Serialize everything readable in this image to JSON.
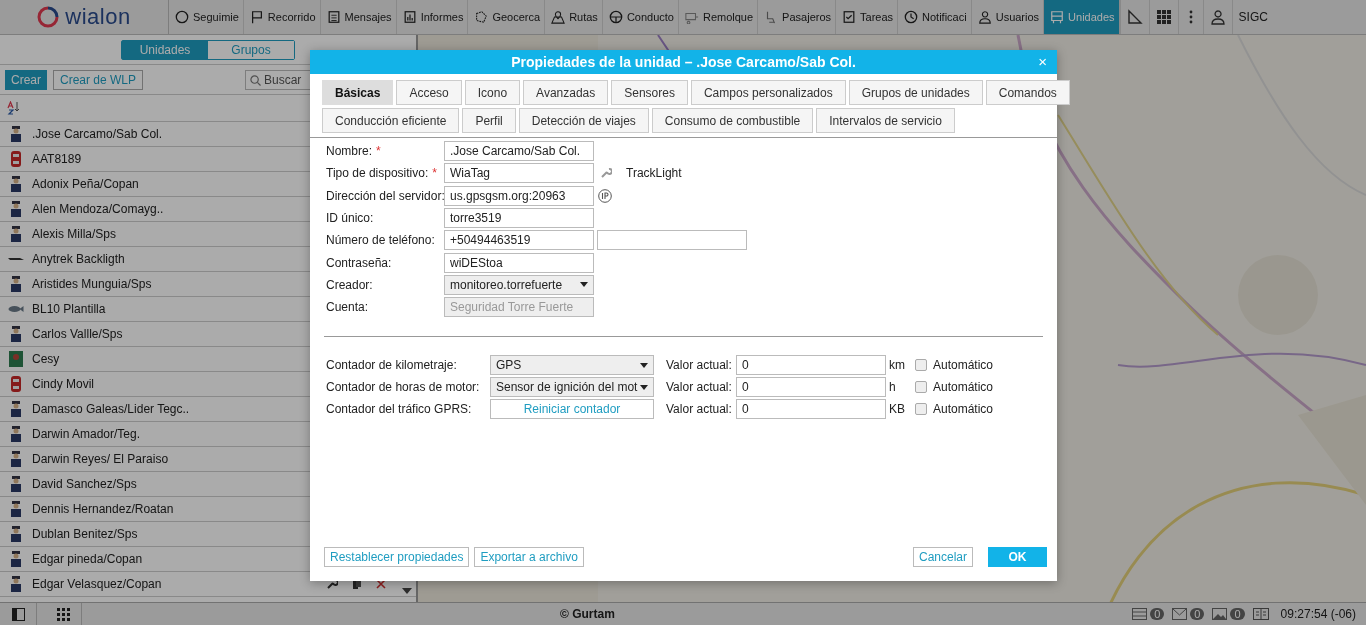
{
  "topbar": {
    "logo": "wialon",
    "tabs": [
      {
        "label": "Seguimie",
        "selected": false
      },
      {
        "label": "Recorrido",
        "selected": false
      },
      {
        "label": "Mensajes",
        "selected": false
      },
      {
        "label": "Informes",
        "selected": false
      },
      {
        "label": "Geocerca",
        "selected": false
      },
      {
        "label": "Rutas",
        "selected": false
      },
      {
        "label": "Conducto",
        "selected": false
      },
      {
        "label": "Remolque",
        "selected": false
      },
      {
        "label": "Pasajeros",
        "selected": false
      },
      {
        "label": "Tareas",
        "selected": false
      },
      {
        "label": "Notificaci",
        "selected": false
      },
      {
        "label": "Usuarios",
        "selected": false
      },
      {
        "label": "Unidades",
        "selected": true
      }
    ],
    "user": "SIGC"
  },
  "sidebar": {
    "segments": [
      {
        "label": "Unidades",
        "selected": true
      },
      {
        "label": "Grupos",
        "selected": false
      }
    ],
    "create": "Crear",
    "create_wlp": "Crear de WLP",
    "search": {
      "placeholder": "Buscar"
    },
    "units": [
      {
        "name": ".Jose Carcamo/Sab Col.",
        "kind": "person"
      },
      {
        "name": "AAT8189",
        "kind": "car"
      },
      {
        "name": "Adonix Peña/Copan",
        "kind": "person"
      },
      {
        "name": "Alen Mendoza/Comayg..",
        "kind": "person"
      },
      {
        "name": "Alexis Milla/Sps",
        "kind": "person"
      },
      {
        "name": "Anytrek Backligth",
        "kind": "device"
      },
      {
        "name": "Aristides Munguia/Sps",
        "kind": "person"
      },
      {
        "name": "BL10 Plantilla",
        "kind": "fish"
      },
      {
        "name": "Carlos Vallle/Sps",
        "kind": "person"
      },
      {
        "name": "Cesy"
      },
      {
        "name": "Cindy Movil",
        "kind": "car"
      },
      {
        "name": "Damasco Galeas/Lider Tegc..",
        "kind": "person"
      },
      {
        "name": "Darwin Amador/Teg.",
        "kind": "person"
      },
      {
        "name": "Darwin Reyes/ El Paraiso",
        "kind": "person"
      },
      {
        "name": "David Sanchez/Sps",
        "kind": "person"
      },
      {
        "name": "Dennis Hernandez/Roatan",
        "kind": "person"
      },
      {
        "name": "Dublan Benitez/Sps",
        "kind": "person"
      },
      {
        "name": "Edgar pineda/Copan",
        "kind": "person"
      },
      {
        "name": "Edgar Velasquez/Copan",
        "kind": "person"
      }
    ]
  },
  "dialog": {
    "title": "Propiedades de la unidad – .Jose Carcamo/Sab Col.",
    "close": "×",
    "tabs": [
      [
        {
          "label": "Básicas",
          "selected": true
        },
        {
          "label": "Acceso",
          "selected": false
        },
        {
          "label": "Icono",
          "selected": false
        },
        {
          "label": "Avanzadas",
          "selected": false
        },
        {
          "label": "Sensores",
          "selected": false
        },
        {
          "label": "Campos personalizados",
          "selected": false
        },
        {
          "label": "Grupos de unidades",
          "selected": false
        },
        {
          "label": "Comandos",
          "selected": false
        }
      ],
      [
        {
          "label": "Conducción eficiente",
          "selected": false
        },
        {
          "label": "Perfil",
          "selected": false
        },
        {
          "label": "Detección de viajes",
          "selected": false
        },
        {
          "label": "Consumo de combustible",
          "selected": false
        },
        {
          "label": "Intervalos de servicio",
          "selected": false
        }
      ]
    ],
    "fields": [
      {
        "label": "Nombre:",
        "required_mark": "*",
        "kind": "text",
        "value": ".Jose Carcamo/Sab Col."
      },
      {
        "label": "Tipo de dispositivo:",
        "required_mark": "*",
        "kind": "text",
        "value": "WiaTag",
        "note": "TrackLight"
      },
      {
        "label": "Dirección del servidor:",
        "kind": "text",
        "value": "us.gpsgsm.org:20963"
      },
      {
        "label": "ID único:",
        "kind": "text",
        "value": "torre3519"
      },
      {
        "label": "Número de teléfono:",
        "kind": "text",
        "value": "+50494463519"
      },
      {
        "label": "Contraseña:",
        "kind": "text",
        "value": "wiDEStoa"
      },
      {
        "label": "Creador:",
        "kind": "select",
        "value": "monitoreo.torrefuerte"
      },
      {
        "label": "Cuenta:",
        "kind": "disabled",
        "value": "Seguridad Torre Fuerte"
      }
    ],
    "counters": [
      {
        "label": "Contador de kilometraje:",
        "kind": "select",
        "control": "GPS",
        "value_label": "Valor actual:",
        "value": "0",
        "unit": "km",
        "auto": "Automático",
        "checked": false
      },
      {
        "label": "Contador de horas de motor:",
        "kind": "select",
        "control": "Sensor de ignición del mot",
        "value_label": "Valor actual:",
        "value": "0",
        "unit": "h",
        "auto": "Automático",
        "checked": false
      },
      {
        "label": "Contador del tráfico GPRS:",
        "kind": "button",
        "control": "Reiniciar contador",
        "value_label": "Valor actual:",
        "value": "0",
        "unit": "KB",
        "auto": "Automático",
        "checked": false
      }
    ],
    "footer": {
      "left": [
        "Restablecer propiedades",
        "Exportar a archivo"
      ],
      "cancel": "Cancelar",
      "ok": "OK"
    }
  },
  "status_bar": {
    "copyright": "© Gurtam",
    "counts": [
      "0",
      "0",
      "0"
    ],
    "time": "09:27:54 (-06)"
  }
}
